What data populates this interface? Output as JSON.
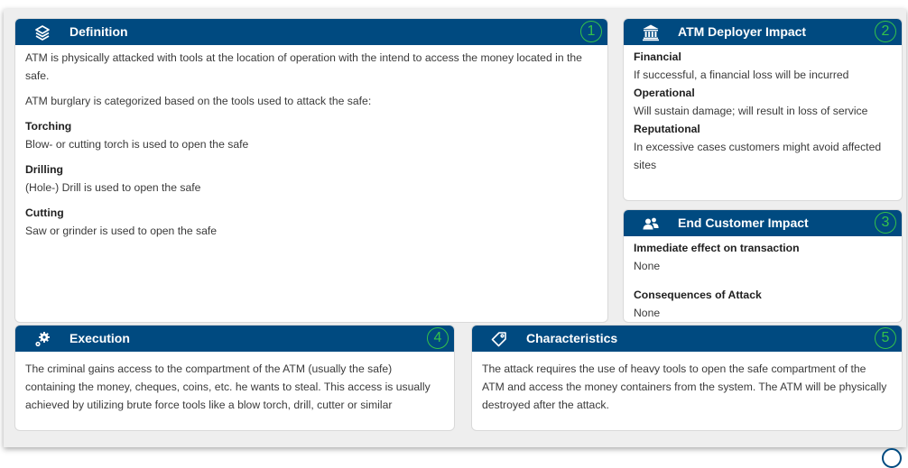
{
  "definition": {
    "title": "Definition",
    "number": "1",
    "icon": "layers-icon",
    "intro": "ATM is physically attacked with tools at the location of operation with the intend to access the money located in the safe.",
    "categorized": "ATM burglary is categorized based on the tools used to attack the safe:",
    "items": [
      {
        "label": "Torching",
        "text": "Blow- or cutting torch is used to open the safe"
      },
      {
        "label": "Drilling",
        "text": "(Hole-) Drill is used to open the safe"
      },
      {
        "label": "Cutting",
        "text": "Saw or grinder is used to open the safe"
      }
    ]
  },
  "deployer": {
    "title": "ATM Deployer Impact",
    "number": "2",
    "icon": "bank-icon",
    "items": [
      {
        "label": "Financial",
        "text": "If successful, a financial loss will be incurred"
      },
      {
        "label": "Operational",
        "text": "Will sustain damage; will result in loss of service"
      },
      {
        "label": "Reputational",
        "text": "In excessive cases customers might avoid affected sites"
      }
    ]
  },
  "customer": {
    "title": "End Customer Impact",
    "number": "3",
    "icon": "users-icon",
    "items": [
      {
        "label": "Immediate effect on transaction",
        "text": "None"
      },
      {
        "label": "Consequences of Attack",
        "text": "None"
      }
    ]
  },
  "execution": {
    "title": "Execution",
    "number": "4",
    "icon": "gears-icon",
    "text": "The criminal gains access to the compartment of the ATM (usually the safe) containing the money, cheques, coins, etc. he wants to steal. This access is usually achieved by utilizing brute force tools like a blow torch, drill, cutter or similar"
  },
  "characteristics": {
    "title": "Characteristics",
    "number": "5",
    "icon": "tag-icon",
    "text": "The attack requires the use of heavy tools to open the safe compartment of the ATM and access the money containers from the system. The ATM will be physically destroyed after the attack."
  },
  "colors": {
    "header": "#004a80",
    "number": "#34c24a"
  }
}
